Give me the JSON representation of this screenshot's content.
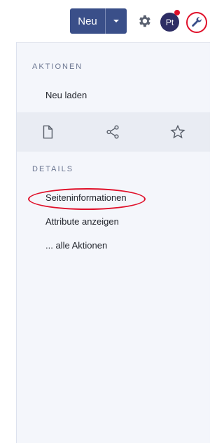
{
  "toolbar": {
    "new_label": "Neu",
    "new_dropdown_icon": "caret-down-icon",
    "settings_icon": "gear-icon",
    "avatar_initials": "Pt",
    "tools_icon": "wrench-icon"
  },
  "panel": {
    "actions_heading": "AKTIONEN",
    "actions_items": [
      {
        "label": "Neu laden"
      }
    ],
    "icon_buttons": [
      {
        "icon": "file-icon"
      },
      {
        "icon": "share-icon"
      },
      {
        "icon": "star-icon"
      }
    ],
    "details_heading": "DETAILS",
    "details_items": [
      {
        "label": "Seiteninformationen"
      },
      {
        "label": "Attribute anzeigen"
      },
      {
        "label": "... alle Aktionen"
      }
    ]
  },
  "colors": {
    "primary": "#3a4f89",
    "highlight": "#e0102a",
    "panel_bg": "#f4f6fb",
    "icon_bar_bg": "#e9ecf3"
  }
}
